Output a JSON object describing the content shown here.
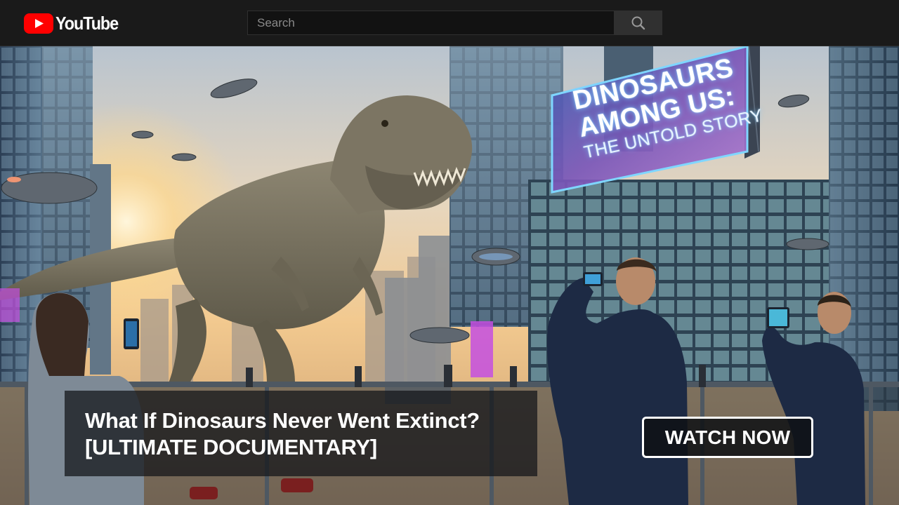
{
  "header": {
    "logo_text": "YouTube",
    "search": {
      "placeholder": "Search",
      "value": ""
    }
  },
  "thumbnail": {
    "billboard": {
      "line1": "DINOSAURS",
      "line2": "AMONG US:",
      "line3": "THE UNTOLD STORY"
    },
    "title_line1": "What If Dinosaurs Never Went Extinct?",
    "title_line2": "[ULTIMATE DOCUMENTARY]",
    "cta_label": "WATCH NOW"
  },
  "colors": {
    "header_bg": "#1a1a1a",
    "brand_red": "#ff0000",
    "search_bg": "#121212",
    "search_button_bg": "#303030",
    "billboard_glow": "#6fc8ff"
  },
  "icons": {
    "logo": "youtube-play-icon",
    "search": "search-icon"
  }
}
